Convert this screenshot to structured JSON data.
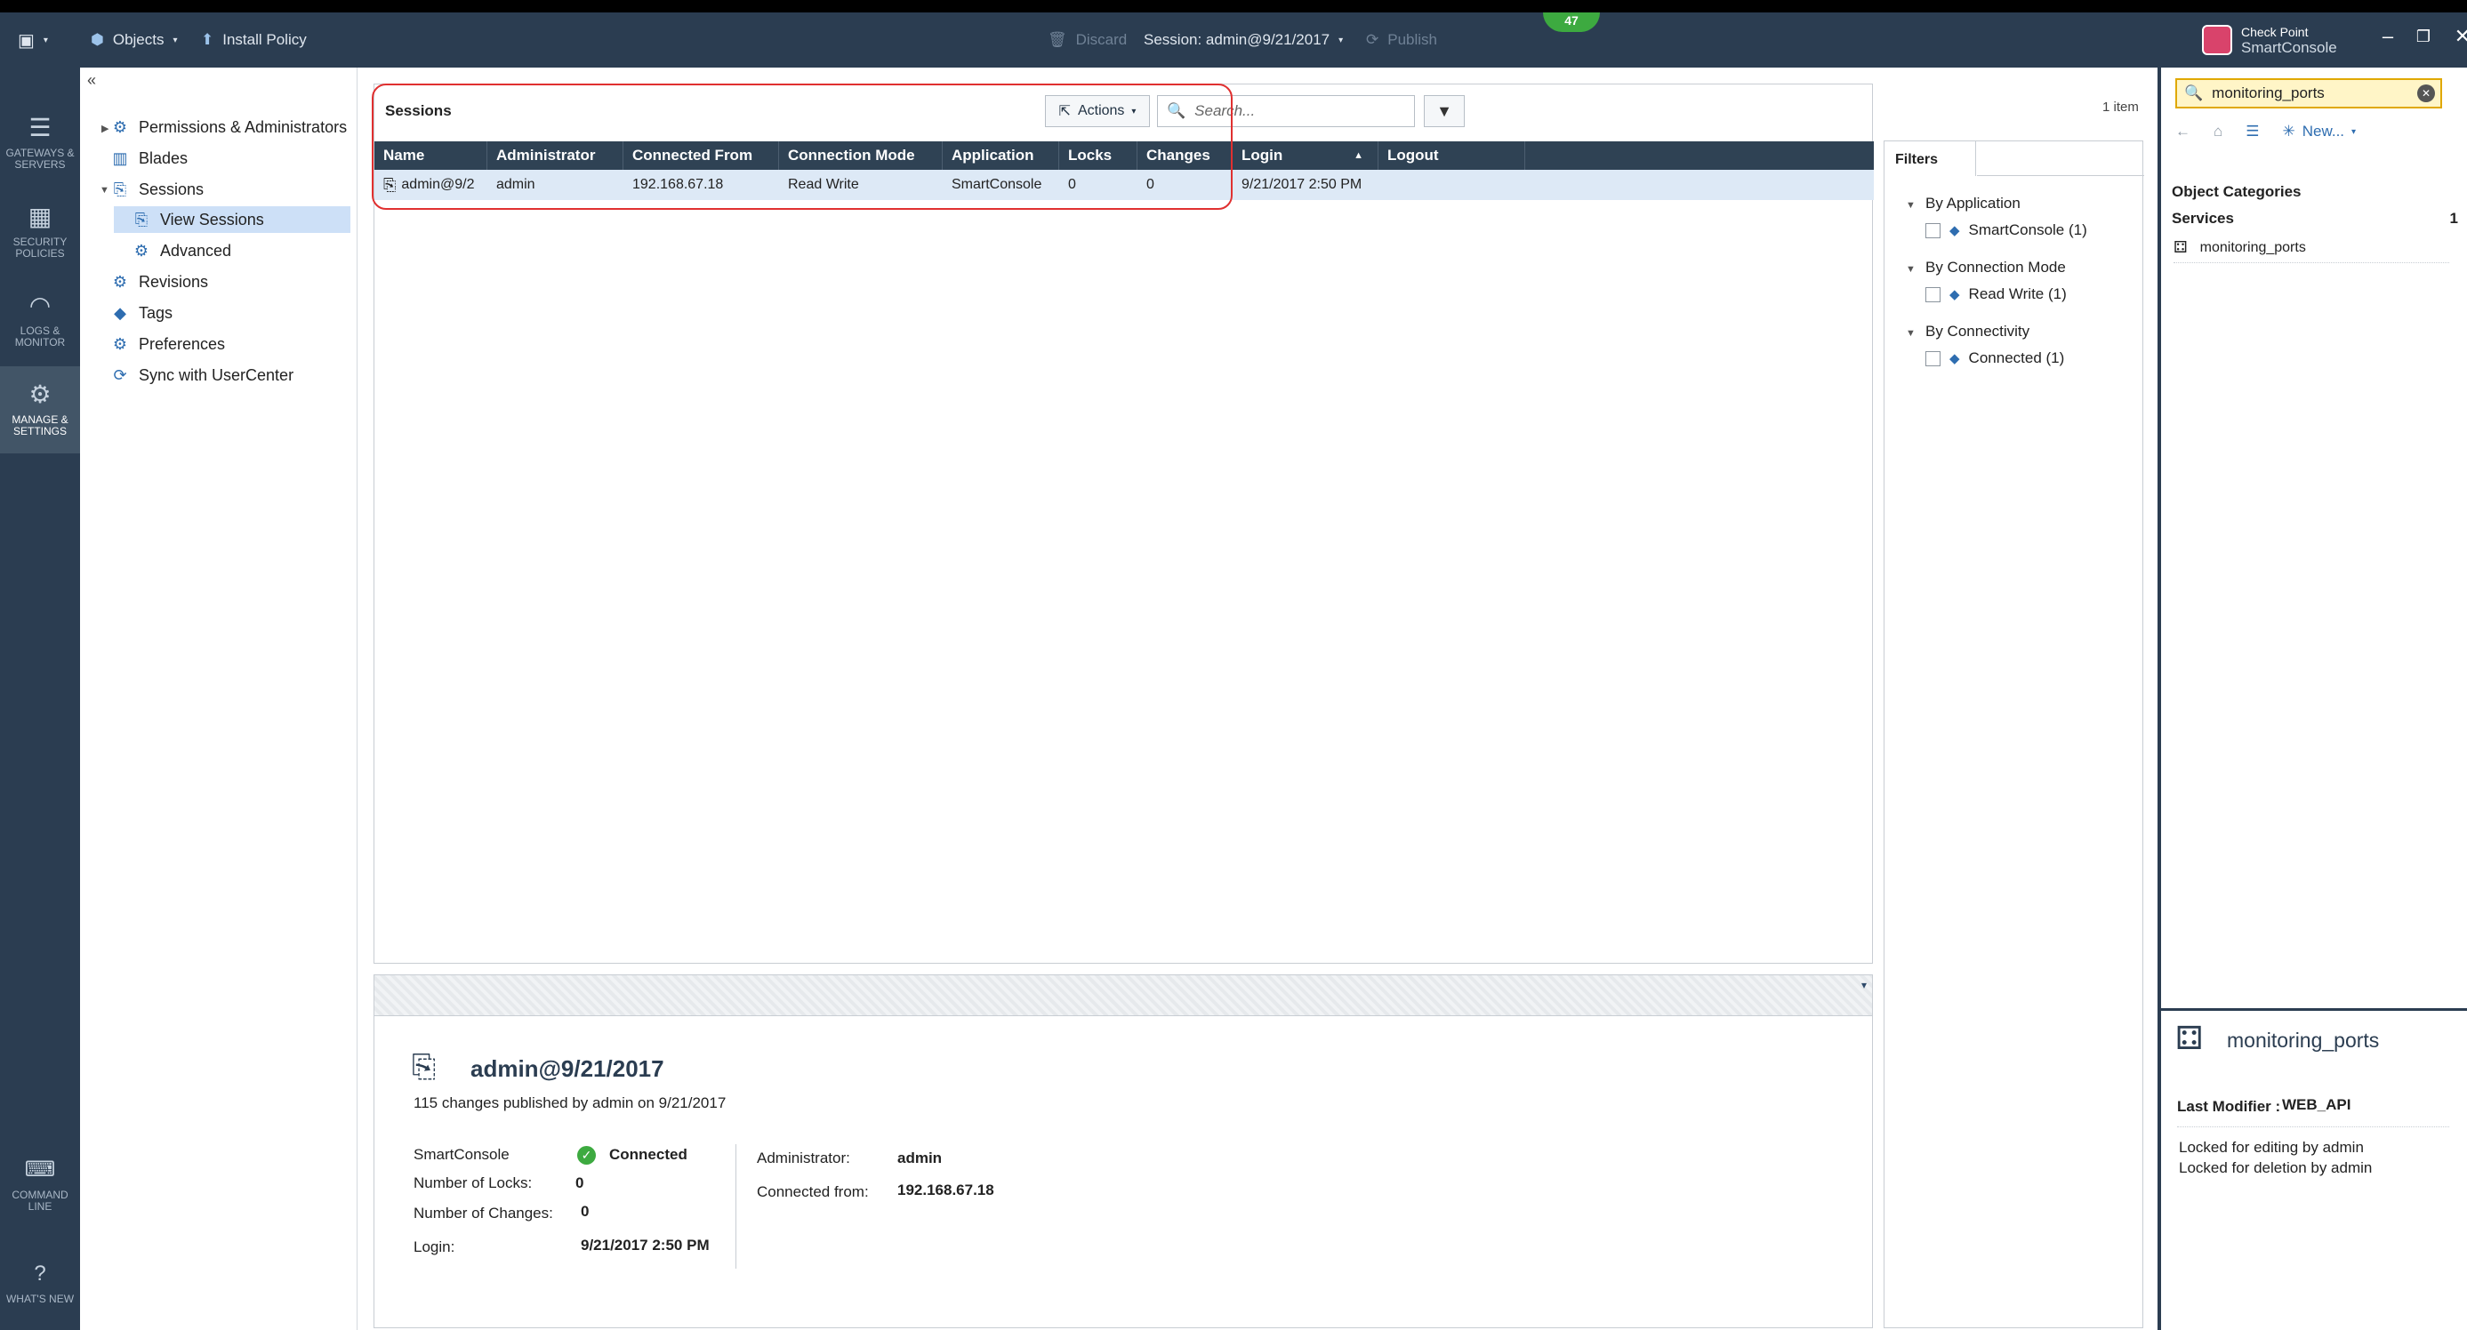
{
  "titlebar": {
    "objects_label": "Objects",
    "install_policy_label": "Install Policy",
    "discard_label": "Discard",
    "session_label": "Session: admin@9/21/2017",
    "publish_label": "Publish",
    "notification_count": "47",
    "brand_line1": "Check Point",
    "brand_line2": "SmartConsole"
  },
  "leftnav": {
    "items": [
      {
        "label": "GATEWAYS & SERVERS",
        "icon": "gateways-icon"
      },
      {
        "label": "SECURITY POLICIES",
        "icon": "policies-icon"
      },
      {
        "label": "LOGS & MONITOR",
        "icon": "monitor-icon"
      },
      {
        "label": "MANAGE & SETTINGS",
        "icon": "gear-icon"
      },
      {
        "label": "COMMAND LINE",
        "icon": "command-line-icon"
      },
      {
        "label": "WHAT'S NEW",
        "icon": "help-icon"
      }
    ]
  },
  "tree": {
    "collapse_glyph": "«",
    "items": [
      {
        "label": "Permissions & Administrators"
      },
      {
        "label": "Blades"
      },
      {
        "label": "Sessions"
      },
      {
        "label": "View Sessions"
      },
      {
        "label": "Advanced"
      },
      {
        "label": "Revisions"
      },
      {
        "label": "Tags"
      },
      {
        "label": "Preferences"
      },
      {
        "label": "Sync with UserCenter"
      }
    ]
  },
  "sessions": {
    "title": "Sessions",
    "actions_label": "Actions",
    "search_placeholder": "Search...",
    "item_count": "1 item",
    "columns": [
      "Name",
      "Administrator",
      "Connected From",
      "Connection Mode",
      "Application",
      "Locks",
      "Changes",
      "Login",
      "Logout"
    ],
    "rows": [
      {
        "name": "admin@9/2",
        "administrator": "admin",
        "connected_from": "192.168.67.18",
        "connection_mode": "Read Write",
        "application": "SmartConsole",
        "locks": "0",
        "changes": "0",
        "login": "9/21/2017 2:50 PM",
        "logout": ""
      }
    ]
  },
  "details": {
    "title": "admin@9/21/2017",
    "subtitle": "115 changes published by admin on 9/21/2017",
    "smartconsole_label": "SmartConsole",
    "connected_value": "Connected",
    "locks_label": "Number of Locks:",
    "locks_value": "0",
    "changes_label": "Number of Changes:",
    "changes_value": "0",
    "login_label": "Login:",
    "login_value": "9/21/2017 2:50 PM",
    "administrator_label": "Administrator:",
    "administrator_value": "admin",
    "connected_from_label": "Connected from:",
    "connected_from_value": "192.168.67.18"
  },
  "filters": {
    "tab_label": "Filters",
    "groups": [
      {
        "label": "By Application",
        "item": "SmartConsole (1)"
      },
      {
        "label": "By Connection Mode",
        "item": "Read Write (1)"
      },
      {
        "label": "By Connectivity",
        "item": "Connected (1)"
      }
    ]
  },
  "object_explorer": {
    "search_value": "monitoring_ports",
    "new_label": "New...",
    "categories_title": "Object Categories",
    "services_label": "Services",
    "services_count": "1",
    "item_label": "monitoring_ports",
    "detail_title": "monitoring_ports",
    "last_modifier_label": "Last Modifier :",
    "last_modifier_value": "WEB_API",
    "lock_line1": "Locked for editing by admin",
    "lock_line2": "Locked for deletion by admin"
  }
}
